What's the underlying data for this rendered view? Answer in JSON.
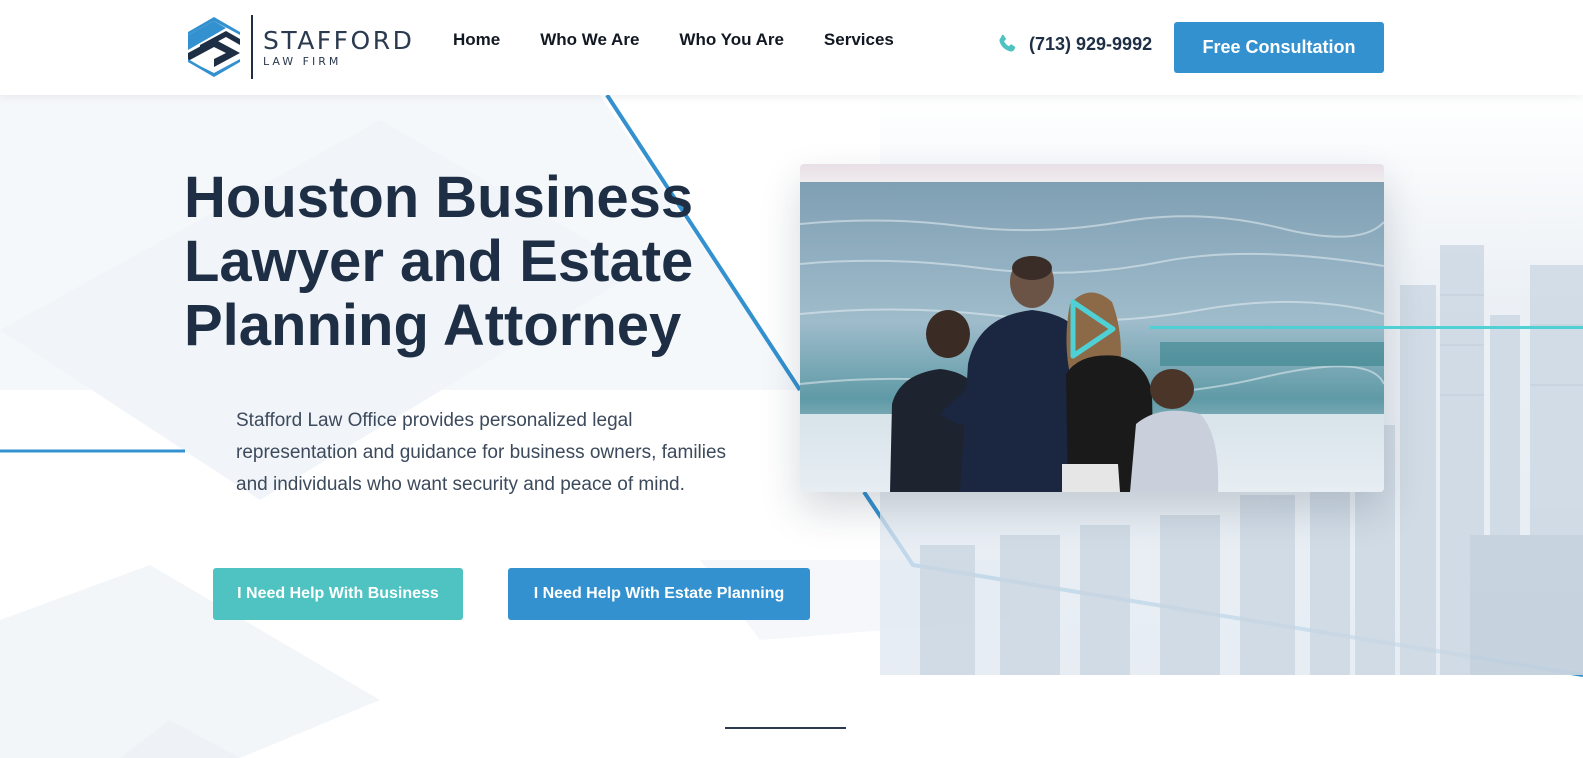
{
  "brand": {
    "name": "STAFFORD",
    "subtitle": "LAW FIRM",
    "colors": {
      "navy": "#1e2f45",
      "blue": "#3491cf",
      "teal": "#4fc3c2",
      "cyan": "#4fd0d4"
    }
  },
  "nav": {
    "items": [
      {
        "label": "Home"
      },
      {
        "label": "Who We Are"
      },
      {
        "label": "Who You Are"
      },
      {
        "label": "Services"
      }
    ]
  },
  "contact": {
    "phone_icon": "phone-icon",
    "phone": "(713) 929-9992",
    "cta_label": "Free Consultation"
  },
  "hero": {
    "title": "Houston Business Lawyer and Estate Planning Attorney",
    "description": "Stafford Law Office provides personalized legal representation and guidance for business owners, families and individuals who want security and peace of mind.",
    "buttons": {
      "business": "I Need Help With Business",
      "estate": "I Need Help With Estate Planning"
    },
    "video_icon": "play-icon"
  }
}
